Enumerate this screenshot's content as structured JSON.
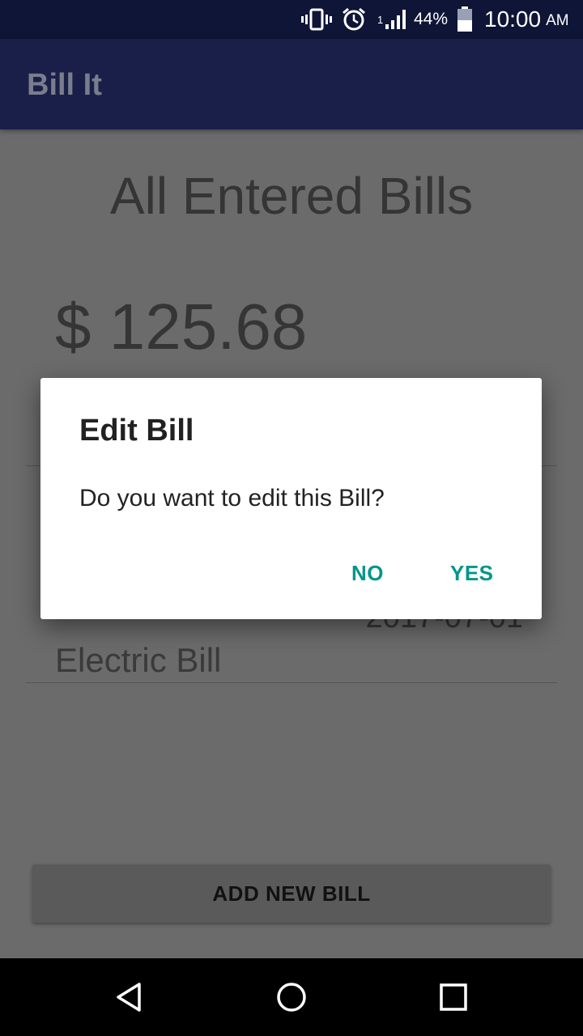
{
  "status_bar": {
    "signal_badge": "1",
    "battery_percent": "44%",
    "time": "10:00",
    "ampm": "AM",
    "icons": [
      "vibrate-icon",
      "alarm-icon",
      "signal-icon",
      "battery-icon"
    ],
    "background": "#0f1536"
  },
  "app_bar": {
    "title": "Bill It",
    "background": "#1a1f4a"
  },
  "main": {
    "heading": "All Entered Bills",
    "total": "$ 125.68",
    "bills": [
      {
        "name": "Electric Bill",
        "date": "2017-07-01"
      }
    ],
    "add_button_label": "ADD NEW BILL"
  },
  "dialog": {
    "title": "Edit Bill",
    "message": "Do you want to edit this Bill?",
    "no_label": "NO",
    "yes_label": "YES",
    "accent_color": "#00968a"
  },
  "nav_bar": {
    "icons": [
      "back-icon",
      "home-icon",
      "recents-icon"
    ]
  }
}
